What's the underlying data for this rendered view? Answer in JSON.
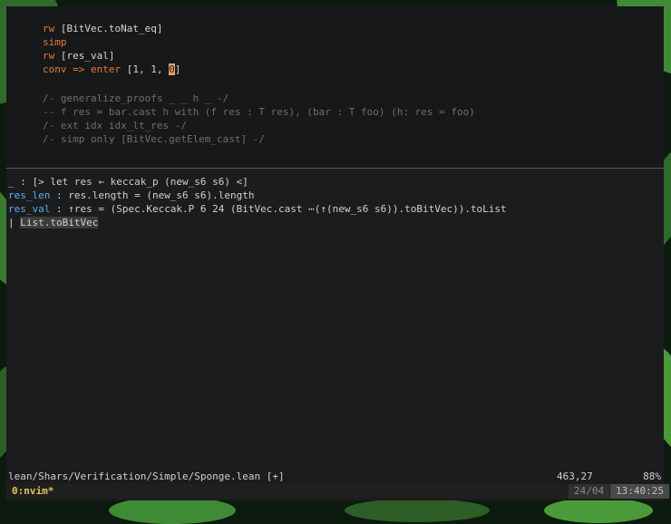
{
  "editor": {
    "code_lines": [
      {
        "kw": "rw",
        "rest": " [BitVec.toNat_eq]"
      },
      {
        "kw": "simp",
        "rest": ""
      },
      {
        "kw": "rw",
        "rest": " [res_val]"
      },
      {
        "kw": "conv => enter",
        "rest": " [1, 1, ",
        "cursor_char": "0",
        "after": "]"
      }
    ],
    "comment_lines": [
      "/- generalize_proofs _ _ h _ -/",
      "-- f res = bar.cast h with (f res : T res), (bar : T foo) (h: res = foo)",
      "/- ext idx idx_lt_res -/",
      "/- simp only [BitVec.getElem_cast] -/"
    ]
  },
  "infoview": {
    "goal_line": "_ : [> let res ← keccak_p (new_s6 s6) <]",
    "hyp1_name": "res_len",
    "hyp1_rest": " : res.length = (new_s6 s6).length",
    "hyp2_name": "res_val",
    "hyp2_rest": " : ↑res = (Spec.Keccak.P 6 24 (BitVec.cast ⋯(↑(new_s6 s6)).toBitVec)).toList",
    "suggestion_prefix": "| ",
    "suggestion": "List.toBitVec"
  },
  "statusline": {
    "file_path": "lean/Shars/Verification/Simple/Sponge.lean [+]",
    "position": "463,27",
    "percent": "88%"
  },
  "tmux": {
    "window": "0:nvim*",
    "date": "24/04",
    "time": "13:40:25"
  }
}
